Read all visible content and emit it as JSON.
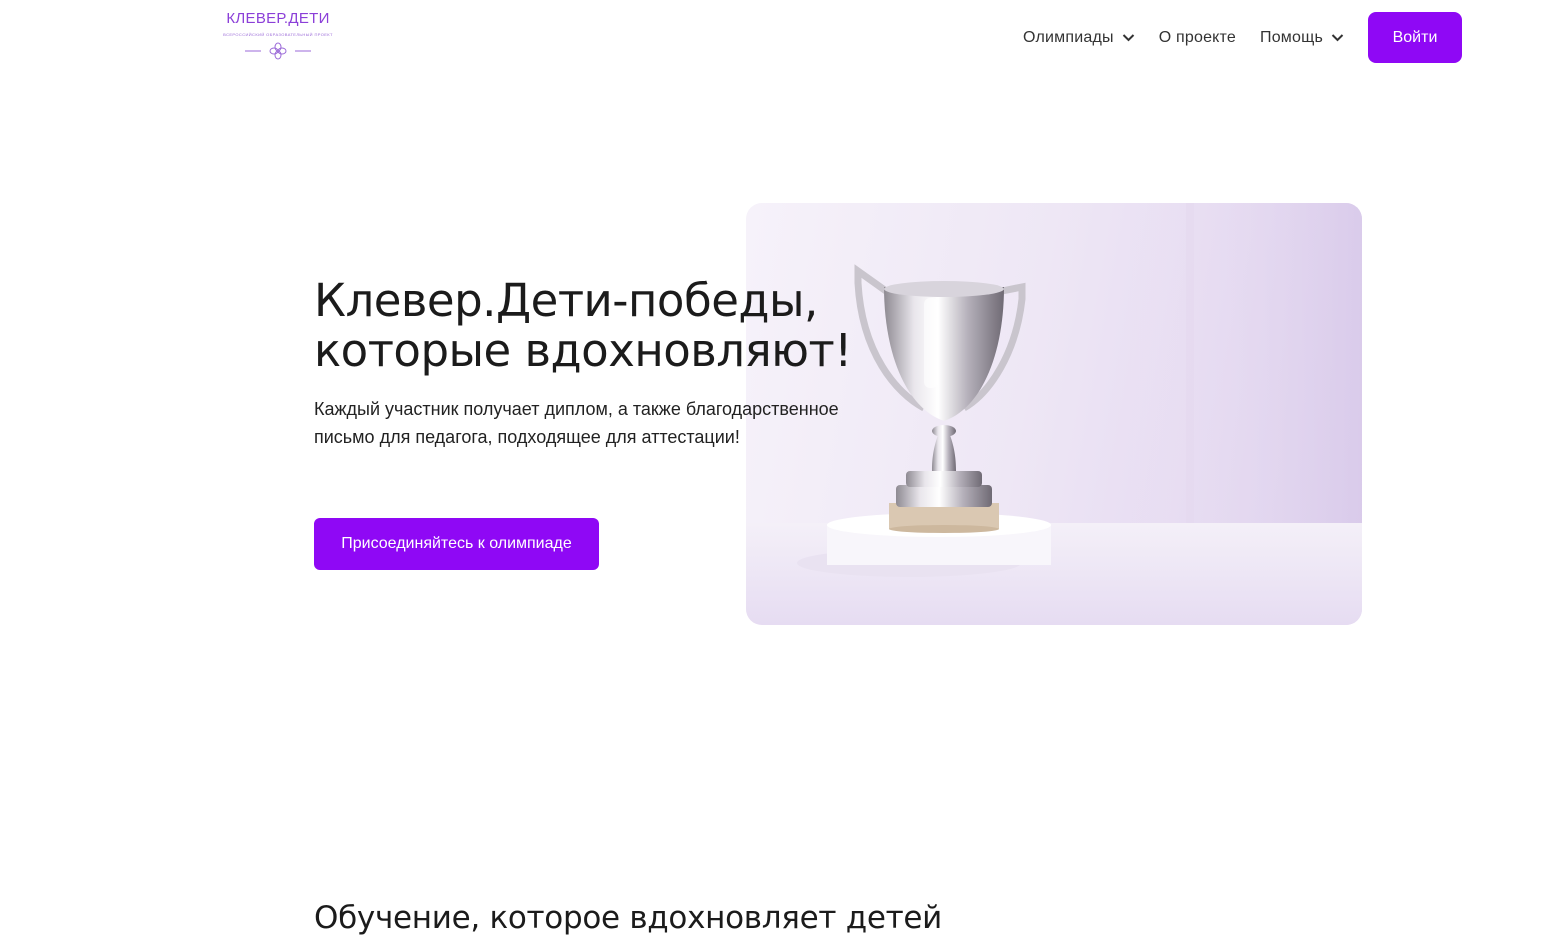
{
  "header": {
    "logo": {
      "title": "КЛЕВЕР.ДЕТИ",
      "subtitle": "ВСЕРОССИЙСКИЙ ОБРАЗОВАТЕЛЬНЫЙ ПРОЕКТ",
      "mark_icon": "clover-icon"
    },
    "nav": {
      "olympiads_label": "Олимпиады",
      "about_label": "О проекте",
      "help_label": "Помощь",
      "dropdown_icon": "chevron-down-icon",
      "login_label": "Войти"
    }
  },
  "hero": {
    "title_line1": "Клевер.Дети-победы,",
    "title_line2": "которые вдохновляют!",
    "text_line1": "Каждый участник получает диплом, а также благодарственное",
    "text_line2": "письмо для педагога, подходящее для аттестации!",
    "cta_label": "Присоединяйтесь к олимпиаде",
    "image_subject": "trophy-cup"
  },
  "section": {
    "title": "Обучение, которое вдохновляет детей"
  },
  "colors": {
    "accent": "#8f08f5",
    "logo": "#8b3fd8",
    "text": "#1b1b1b"
  }
}
